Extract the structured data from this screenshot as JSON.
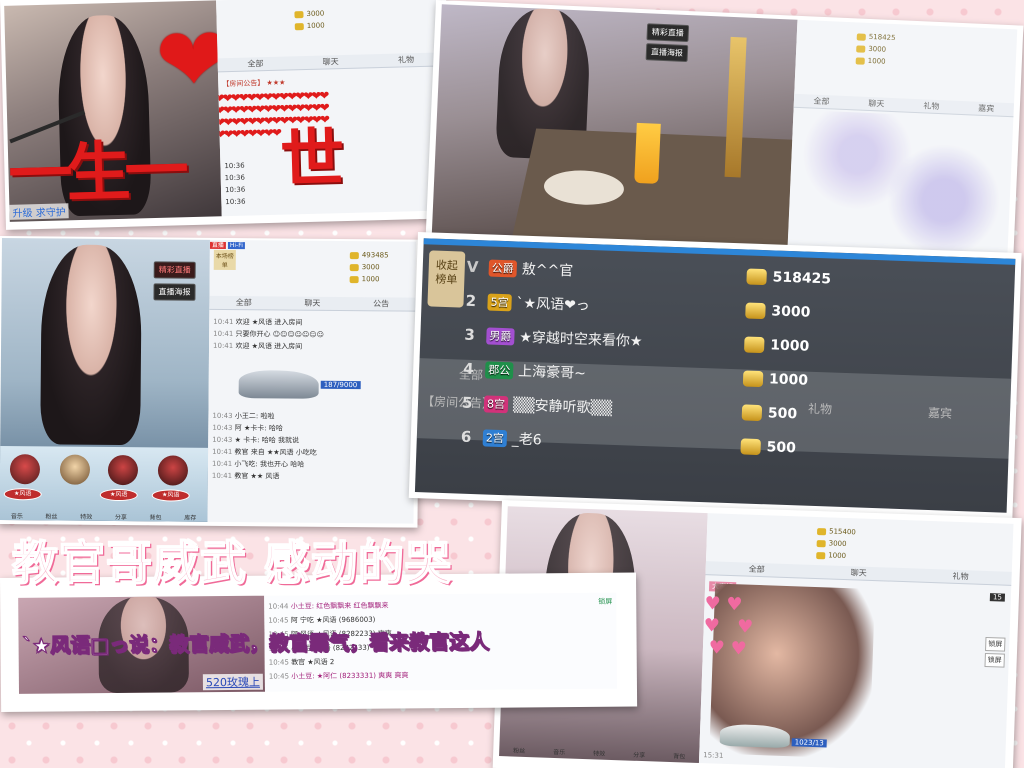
{
  "caption": "教官哥威武 感动的哭",
  "card1": {
    "overlay_text": "一生一世",
    "bottom_left": "升级  求守护",
    "gift_rows": [
      {
        "amount": "3000"
      },
      {
        "amount": "1000"
      }
    ],
    "tabs": [
      "全部",
      "聊天",
      "礼物"
    ],
    "system_line": "【房间公告】 ★★★",
    "chat_times": [
      "10:36",
      "10:36",
      "10:36",
      "10:36",
      "10:36",
      "10:36",
      "10:36"
    ],
    "gift_btn": "★风语"
  },
  "card2": {
    "buttons": [
      "精彩直播",
      "直播海报"
    ],
    "amounts": [
      "518425",
      "3000",
      "1000"
    ],
    "tabs": [
      "全部",
      "聊天",
      "礼物",
      "嘉宾"
    ]
  },
  "card3": {
    "top_labels": [
      "直播",
      "Hi-Fi"
    ],
    "buttons": [
      "精彩直播",
      "直播海报"
    ],
    "rank_badge": "本场榜单",
    "amounts": [
      "493485",
      "3000",
      "1000"
    ],
    "tabs": [
      "全部",
      "聊天",
      "公告"
    ],
    "chat": [
      {
        "time": "10:41",
        "text": "欢迎 ★风语 进入房间"
      },
      {
        "time": "10:41",
        "text": "只要你开心 ☺☺☺☺☺☺☺"
      },
      {
        "time": "10:41",
        "text": "欢迎 ★风语 进入房间"
      },
      {
        "time": "10:43",
        "text": "小王二: 啦啦"
      },
      {
        "time": "10:43",
        "text": "阿 ★卡卡: 哈哈"
      },
      {
        "time": "10:43",
        "text": "★ 卡卡: 哈哈 我就说"
      },
      {
        "time": "10:41",
        "text": "教官 来自 ★★风语 小吃吃"
      },
      {
        "time": "10:41",
        "text": "小飞吃: 我也开心 哈哈"
      },
      {
        "time": "10:41",
        "text": "教官 ★★ 风语"
      }
    ],
    "car_count": "187/9000",
    "podium": [
      "★风语",
      "★风语",
      "★风语"
    ],
    "bottom_icons": [
      "音乐",
      "粉丝",
      "特效",
      "分享",
      "背包",
      "库存"
    ]
  },
  "leaderboard": {
    "collapse_label": "收起\n榜单",
    "rows": [
      {
        "rank": "",
        "badge": "公爵",
        "badge_color": "#e0562a",
        "name": "敖^^官",
        "amount": "518425"
      },
      {
        "rank": "2",
        "badge": "5宫",
        "badge_color": "#d9a21a",
        "name": "`★风语❤っ",
        "amount": "3000"
      },
      {
        "rank": "3",
        "badge": "男爵",
        "badge_color": "#a34fd0",
        "name": "★穿越时空来看你★",
        "amount": "1000"
      },
      {
        "rank": "4",
        "badge": "郡公",
        "badge_color": "#1f8f4a",
        "name": "上海豪哥~",
        "amount": "1000"
      },
      {
        "rank": "5",
        "badge": "8宫",
        "badge_color": "#d2327a",
        "name": "▒▒安静听歌▒▒",
        "amount": "500"
      },
      {
        "rank": "6",
        "badge": "2宫",
        "badge_color": "#2f7fd3",
        "name": "_老6",
        "amount": "500"
      }
    ],
    "ghost_tabs": [
      "全部",
      "礼物",
      "嘉宾"
    ],
    "ghost_notice": "【房间公告】"
  },
  "card5": {
    "subcaption": "`★风语□っ说：教官威武，教官霸气，看来教官这人",
    "bottom_label": "520玫瑰上",
    "chat": [
      {
        "time": "10:44",
        "text": "小土豆: 红色飘飘来  红色飘飘来"
      },
      {
        "time": "10:45",
        "text": "阿 宁吃 ★风语 (9686003)"
      },
      {
        "time": "10:45",
        "text": "阿 风语 ★风语 (8282233) 爽爽"
      },
      {
        "time": "10:45",
        "text": "小土豆: 风语 (8282233)"
      },
      {
        "time": "10:45",
        "text": "教官 ★风语 2"
      },
      {
        "time": "10:45",
        "text": "小土豆: ★阿仁 (8233331) 爽爽  爽爽"
      }
    ],
    "check_labels": [
      "锁屏"
    ]
  },
  "card6": {
    "amounts": [
      "515400",
      "3000",
      "1000"
    ],
    "tabs": [
      "全部",
      "聊天",
      "礼物"
    ],
    "tag": "大家好",
    "count": "15",
    "car_count": "1023/13",
    "right_labels": [
      "锁屏",
      "锁屏"
    ],
    "bottom_time": "15:31",
    "bottom_icons": [
      "粉丝",
      "音乐",
      "特效",
      "分享",
      "背包"
    ]
  }
}
